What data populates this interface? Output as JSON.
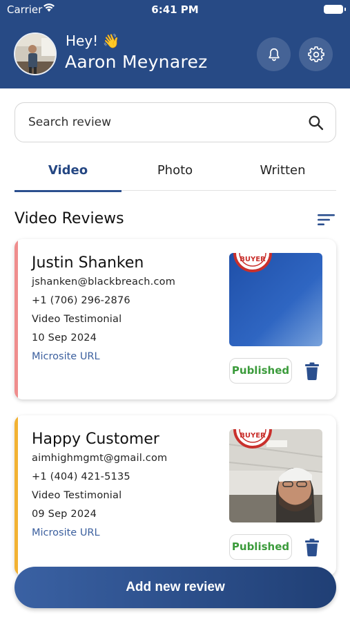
{
  "status_bar": {
    "carrier": "Carrier",
    "time": "6:41 PM"
  },
  "header": {
    "greeting": "Hey!",
    "greeting_emoji": "👋",
    "user_name": "Aaron Meynarez",
    "icons": [
      "bell-icon",
      "gear-icon"
    ]
  },
  "search": {
    "placeholder": "Search review"
  },
  "tabs": [
    {
      "label": "Video",
      "active": true
    },
    {
      "label": "Photo",
      "active": false
    },
    {
      "label": "Written",
      "active": false
    }
  ],
  "section": {
    "title": "Video Reviews"
  },
  "reviews": [
    {
      "name": "Justin Shanken",
      "email": "jshanken@blackbreach.com",
      "phone": "+1 (706) 296-2876",
      "type": "Video Testimonial",
      "date": "10 Sep 2024",
      "link": "Microsite URL",
      "status": "Published",
      "accent_color": "#ef8d8d"
    },
    {
      "name": "Happy Customer",
      "email": "aimhighmgmt@gmail.com",
      "phone": "+1 (404) 421-5135",
      "type": "Video Testimonial",
      "date": "09 Sep 2024",
      "link": "Microsite URL",
      "status": "Published",
      "accent_color": "#f2b233"
    }
  ],
  "add_button": {
    "label": "Add new review"
  },
  "colors": {
    "header_bg": "#274a85",
    "accent": "#254783",
    "published_green": "#3b9b3b",
    "link_blue": "#3b5f9e"
  }
}
